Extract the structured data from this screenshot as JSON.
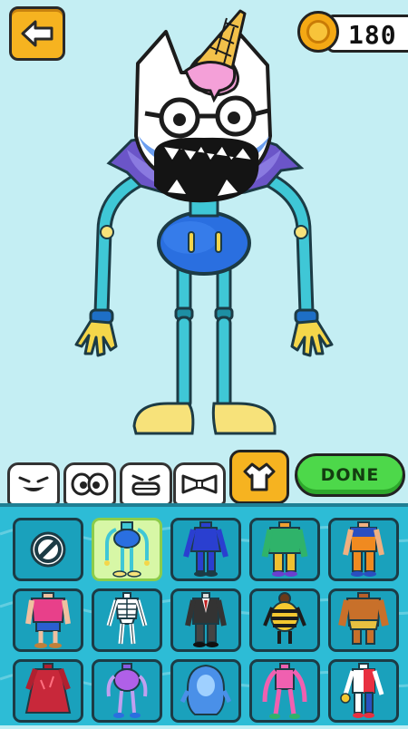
{
  "hud": {
    "coins": "180"
  },
  "buttons": {
    "done_label": "DONE"
  },
  "colors": {
    "accent": "#f6b320",
    "done": "#4dd84a",
    "panel": "#2dbcd6",
    "background": "#c4eef3"
  },
  "category_tabs": [
    {
      "name": "mouth-tab",
      "icon": "grin-face-icon"
    },
    {
      "name": "eyes-tab",
      "icon": "eyes-icon"
    },
    {
      "name": "teeth-tab",
      "icon": "teeth-face-icon"
    },
    {
      "name": "bowtie-tab",
      "icon": "bowtie-icon"
    },
    {
      "name": "body-tab",
      "icon": "body-shirt-icon",
      "active": true
    }
  ],
  "body_options": [
    {
      "id": "none",
      "icon": "no-entry-icon"
    },
    {
      "id": "robot-blue",
      "icon": "robot-body-icon",
      "selected": true
    },
    {
      "id": "blue-suit",
      "icon": "blue-body-icon"
    },
    {
      "id": "green-hoodie",
      "icon": "green-body-icon"
    },
    {
      "id": "orange-ninja",
      "icon": "orange-body-icon"
    },
    {
      "id": "pink-shirt",
      "icon": "pink-shirt-body-icon"
    },
    {
      "id": "skeleton",
      "icon": "skeleton-body-icon"
    },
    {
      "id": "black-suit",
      "icon": "suit-body-icon"
    },
    {
      "id": "bee",
      "icon": "bee-body-icon"
    },
    {
      "id": "brown-caveman",
      "icon": "caveman-body-icon"
    },
    {
      "id": "red-cape",
      "icon": "red-cape-body-icon"
    },
    {
      "id": "purple-robot",
      "icon": "purple-robot-body-icon"
    },
    {
      "id": "blue-blob",
      "icon": "blob-body-icon"
    },
    {
      "id": "pink-long",
      "icon": "pink-long-body-icon"
    },
    {
      "id": "red-white",
      "icon": "red-white-body-icon"
    }
  ]
}
